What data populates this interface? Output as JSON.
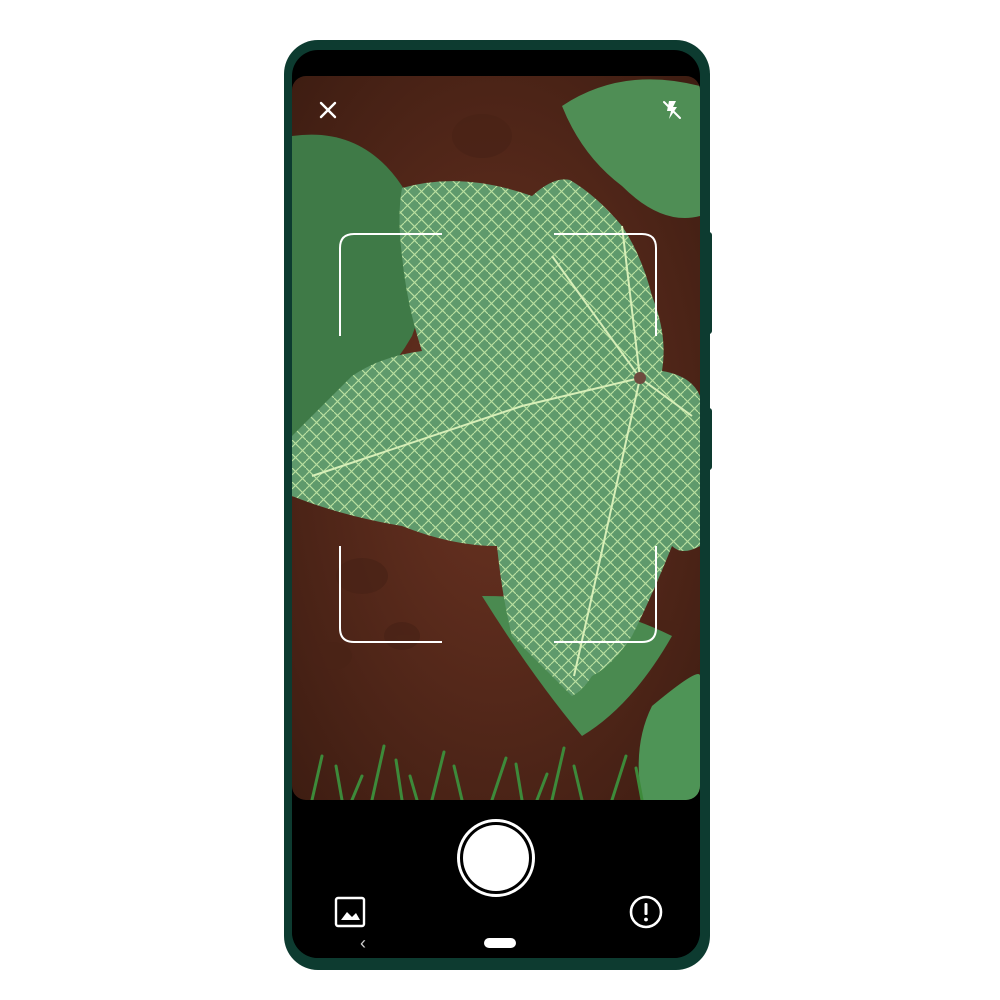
{
  "app": {
    "screen": "camera-viewfinder",
    "icons": {
      "close": "close-icon",
      "flash": "flash-off-icon",
      "gallery": "image-gallery-icon",
      "shutter": "shutter-icon",
      "info": "info-icon",
      "nav_back": "back-chevron-icon",
      "nav_home": "home-pill-icon"
    },
    "nav": {
      "back_glyph": "‹"
    }
  },
  "colors": {
    "phone_frame": "#0d3b30",
    "screen_bg": "#000000",
    "viewfinder_frame": "#ffffff",
    "leaf_green": "#5f9a6c",
    "leaf_vein": "#b9e0a0",
    "soil": "#5a2a1c"
  }
}
